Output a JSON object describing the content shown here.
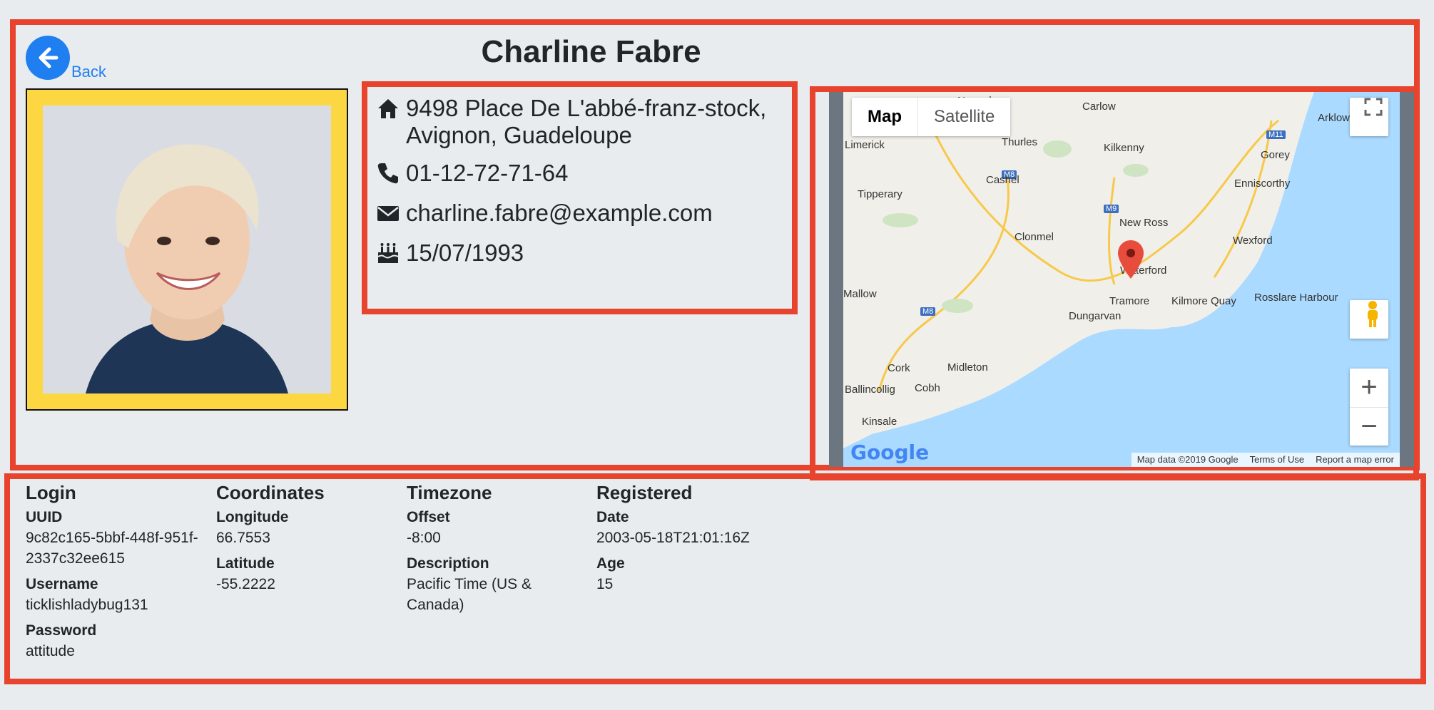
{
  "header": {
    "back_label": "Back",
    "name": "Charline Fabre"
  },
  "contact": {
    "address": "9498 Place De L'abbé-franz-stock, Avignon, Guadeloupe",
    "phone": "01-12-72-71-64",
    "email": "charline.fabre@example.com",
    "birthday": "15/07/1993"
  },
  "map": {
    "type_map": "Map",
    "type_satellite": "Satellite",
    "zoom_in": "+",
    "zoom_out": "−",
    "logo": "Google",
    "data_credit": "Map data ©2019 Google",
    "terms": "Terms of Use",
    "report": "Report a map error",
    "places": [
      "Carlow",
      "Nenagh",
      "Arklow",
      "Limerick",
      "Thurles",
      "Kilkenny",
      "M11",
      "Gorey",
      "M8",
      "Cashel",
      "Enniscorthy",
      "Tipperary",
      "M9",
      "New Ross",
      "Clonmel",
      "Wexford",
      "Waterford",
      "Mallow",
      "Tramore",
      "Kilmore Quay",
      "Rosslare Harbour",
      "M8",
      "Dungarvan",
      "Cork",
      "Midleton",
      "Ballincollig",
      "Cobh",
      "Kinsale"
    ],
    "colors": {
      "water": "#aadaff",
      "land": "#f1efe9",
      "marker": "#e74c3c",
      "road": "#f7c94a"
    }
  },
  "details": {
    "login": {
      "title": "Login",
      "uuid_label": "UUID",
      "uuid": "9c82c165-5bbf-448f-951f-2337c32ee615",
      "username_label": "Username",
      "username": "ticklishladybug131",
      "password_label": "Password",
      "password": "attitude"
    },
    "coordinates": {
      "title": "Coordinates",
      "longitude_label": "Longitude",
      "longitude": "66.7553",
      "latitude_label": "Latitude",
      "latitude": "-55.2222"
    },
    "timezone": {
      "title": "Timezone",
      "offset_label": "Offset",
      "offset": "-8:00",
      "description_label": "Description",
      "description": "Pacific Time (US & Canada)"
    },
    "registered": {
      "title": "Registered",
      "date_label": "Date",
      "date": "2003-05-18T21:01:16Z",
      "age_label": "Age",
      "age": "15"
    }
  },
  "icons": [
    "back-arrow-icon",
    "home-icon",
    "phone-icon",
    "envelope-icon",
    "birthday-cake-icon",
    "fullscreen-icon",
    "pegman-icon",
    "map-marker-icon"
  ],
  "accent_colors": {
    "frame": "#e8432d",
    "back": "#1f7ff0",
    "photo_border": "#fcd742"
  }
}
